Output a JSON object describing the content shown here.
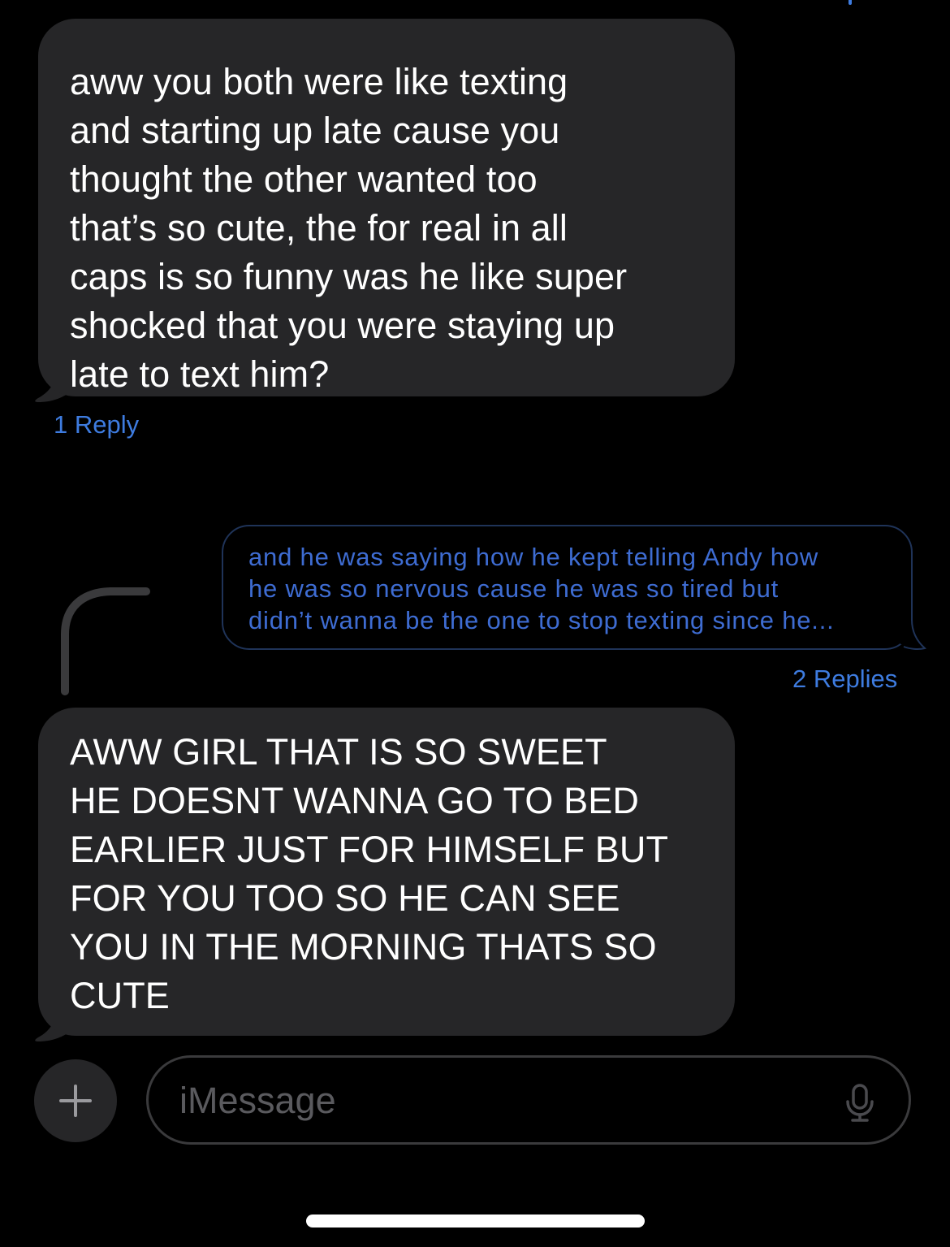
{
  "conversation": {
    "messages": [
      {
        "direction": "incoming",
        "text": "aww you both were like texting\nand starting up late cause you\nthought the other wanted too\nthat’s so cute, the for real in all\ncaps is so funny was he like super\nshocked that you were staying up\nlate to text him?",
        "reply_count": "1 Reply"
      },
      {
        "direction": "outgoing-quoted",
        "text": "and he was saying how he kept telling Andy how\nhe was so nervous cause he was so tired but\ndidn’t wanna be the one to stop texting since he...",
        "reply_count": "2 Replies"
      },
      {
        "direction": "incoming",
        "text": "AWW GIRL THAT IS SO SWEET\nHE DOESNT WANNA GO TO BED\nEARLIER JUST FOR HIMSELF BUT\nFOR YOU TOO SO HE CAN SEE\nYOU IN THE MORNING THATS SO\nCUTE"
      }
    ]
  },
  "composer": {
    "placeholder": "iMessage",
    "add_icon": "plus-icon",
    "mic_icon": "microphone-icon"
  },
  "colors": {
    "background": "#000000",
    "incoming_bubble": "#262628",
    "accent_blue": "#3e7ce0",
    "quoted_text": "#3e6cd2",
    "placeholder": "#5a5a5e"
  }
}
